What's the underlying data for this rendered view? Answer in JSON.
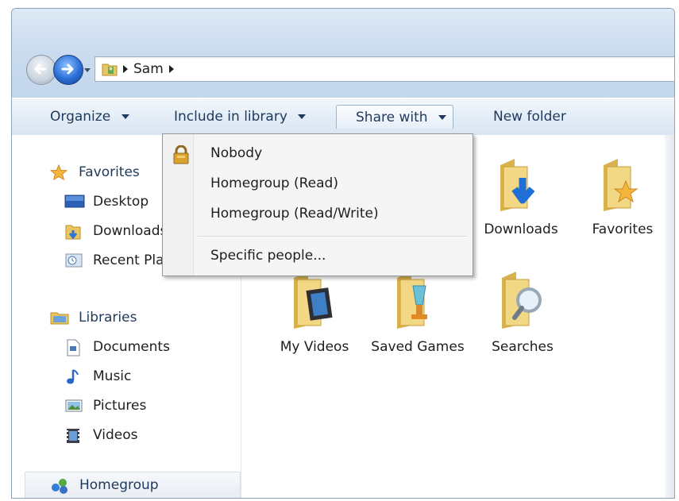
{
  "address": {
    "crumbs": [
      "Sam"
    ]
  },
  "toolbar": {
    "organize": "Organize",
    "include_in_library": "Include in library",
    "share_with": "Share with",
    "new_folder": "New folder"
  },
  "sidebar": {
    "favorites": {
      "label": "Favorites",
      "items": [
        "Desktop",
        "Downloads",
        "Recent Places"
      ]
    },
    "libraries": {
      "label": "Libraries",
      "items": [
        "Documents",
        "Music",
        "Pictures",
        "Videos"
      ]
    },
    "homegroup": "Homegroup"
  },
  "content": {
    "items": [
      "Downloads",
      "Favorites",
      "My Videos",
      "Saved Games",
      "Searches"
    ]
  },
  "share_menu": {
    "items": [
      "Nobody",
      "Homegroup (Read)",
      "Homegroup (Read/Write)",
      "Specific people..."
    ]
  },
  "colors": {
    "accent": "#1e395b",
    "toolbar_bg": "#e4edf7",
    "menu_bg": "#f5f5f5"
  }
}
